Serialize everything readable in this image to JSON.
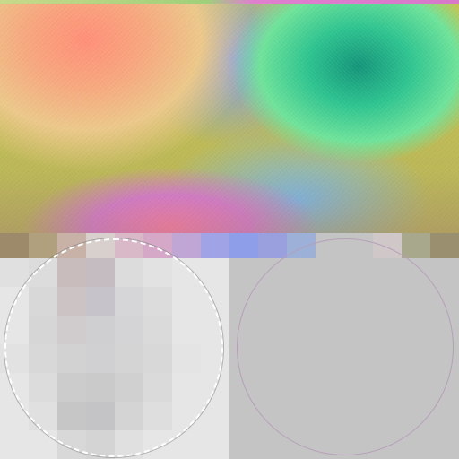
{
  "canvas": {
    "top_strip_colors": [
      "#c8d98a",
      "#e07fd0"
    ],
    "preview_colors": [
      "#ff8f78",
      "#ecc88a",
      "#7a9af0",
      "#2ec490",
      "#14957a",
      "#ff7aa8",
      "#79b8e8",
      "#c7c44e"
    ]
  },
  "band": {
    "colors": [
      "#9c8a6a",
      "#b0a07e",
      "#c8b2a8",
      "#d8d0cc",
      "#d9b9c8",
      "#d6a8c8",
      "#c0a6d4",
      "#a0a4e6",
      "#8e9ee8",
      "#9aa0de",
      "#9cb0d8",
      "#c4c4c4",
      "#c4c4c4",
      "#d0c8c8",
      "#a8a88c",
      "#9a9070"
    ]
  },
  "pixel_swatch": {
    "colors": [
      [
        "#e0e0e0",
        "#dcdcdc",
        "#c8bcbc",
        "#c4bcc0",
        "#dcdcdc",
        "#e2e2e2",
        "#e6e6e6",
        "#e6e6e6"
      ],
      [
        "#e6e6e6",
        "#d8d8d8",
        "#cbc3c4",
        "#c6c4ca",
        "#d6d6d8",
        "#dcdcdc",
        "#e6e6e6",
        "#e6e6e6"
      ],
      [
        "#e6e6e6",
        "#d6d6d6",
        "#d0cccd",
        "#cfcfd2",
        "#d4d4d6",
        "#dadada",
        "#e6e6e6",
        "#e6e6e6"
      ],
      [
        "#e2e2e2",
        "#d8d8d8",
        "#d2d2d2",
        "#d0d0d2",
        "#d4d4d4",
        "#d8d8d8",
        "#e4e4e4",
        "#e6e6e6"
      ],
      [
        "#e6e6e6",
        "#dcdcdc",
        "#cccccc",
        "#cacaca",
        "#d0d0d0",
        "#dadada",
        "#e6e6e6",
        "#e6e6e6"
      ],
      [
        "#e6e6e6",
        "#e0e0e0",
        "#c6c6c6",
        "#c4c4c6",
        "#d4d4d4",
        "#dedede",
        "#e6e6e6",
        "#e6e6e6"
      ],
      [
        "#e6e6e6",
        "#e6e6e6",
        "#d8d8d8",
        "#d4d4d4",
        "#e0e0e0",
        "#e6e6e6",
        "#e6e6e6",
        "#e6e6e6"
      ]
    ]
  },
  "selection": {
    "outline_color": "#b69fb8",
    "fill_color": "#c4c4c4"
  }
}
